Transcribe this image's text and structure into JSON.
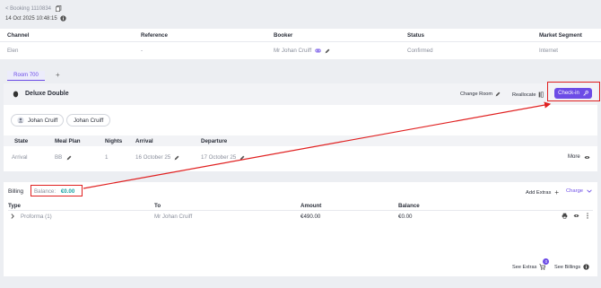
{
  "header": {
    "back_link": "< Booking 1110834",
    "datetime": "14 Oct 2025 10:48:15"
  },
  "summary": {
    "columns": [
      "Channel",
      "Reference",
      "Booker",
      "Status",
      "Market Segment"
    ],
    "values": [
      "Elen",
      "-",
      "Mr Johan Cruiff",
      "Confirmed",
      "Internet"
    ]
  },
  "room": {
    "tab_label": "Room 700",
    "add_tab": "+",
    "type": "Deluxe Double",
    "change_room": "Change Room",
    "reallocate": "Reallocate",
    "checkin": "Check-in",
    "guests": [
      "Johan Cruiff",
      "Johan Cruiff"
    ],
    "columns": [
      "State",
      "Meal Plan",
      "Nights",
      "Arrival",
      "Departure"
    ],
    "values": [
      "Arrival",
      "BB",
      "1",
      "16 October 25",
      "17 October 25"
    ],
    "more": "More"
  },
  "billing": {
    "title": "Billing",
    "balance_label": "Balance:",
    "balance_value": "€0.00",
    "add_extras": "Add Extras",
    "charge": "Charge",
    "columns": [
      "Type",
      "To",
      "Amount",
      "Balance"
    ],
    "row": {
      "type": "Proforma (1)",
      "to": "Mr Johan Cruiff",
      "amount": "€490.00",
      "balance": "€0.00"
    },
    "see_extras": "See Extras",
    "extras_badge": "0",
    "see_billings": "See Billings"
  },
  "colors": {
    "accent": "#6c4ce6",
    "annotation": "#e02020",
    "balance": "#17a2a2"
  }
}
